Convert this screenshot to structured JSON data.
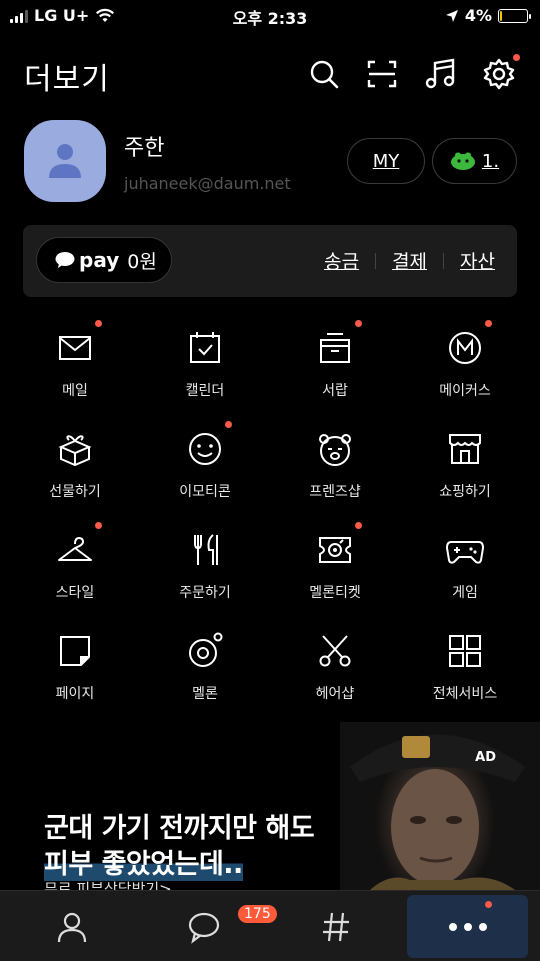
{
  "status": {
    "carrier": "LG U+",
    "time": "오후 2:33",
    "battery": "4%",
    "battery_level": 0.04
  },
  "header": {
    "title": "더보기",
    "icons": [
      "search-icon",
      "scan-icon",
      "music-icon",
      "settings-icon"
    ]
  },
  "profile": {
    "name": "주한",
    "email": "juhaneek@daum.net",
    "my_label": "MY",
    "emoticon_count": "1."
  },
  "pay": {
    "logo": "pay",
    "balance": "0원",
    "links": [
      "송금",
      "결제",
      "자산"
    ]
  },
  "grid": [
    {
      "label": "메일",
      "icon": "mail-icon",
      "dot": true
    },
    {
      "label": "캘린더",
      "icon": "calendar-icon",
      "dot": false
    },
    {
      "label": "서랍",
      "icon": "drawer-icon",
      "dot": true
    },
    {
      "label": "메이커스",
      "icon": "makers-icon",
      "dot": true
    },
    {
      "label": "선물하기",
      "icon": "gift-icon",
      "dot": false
    },
    {
      "label": "이모티콘",
      "icon": "emoticon-icon",
      "dot": true
    },
    {
      "label": "프렌즈샵",
      "icon": "friends-shop-icon",
      "dot": false
    },
    {
      "label": "쇼핑하기",
      "icon": "shopping-icon",
      "dot": false
    },
    {
      "label": "스타일",
      "icon": "hanger-icon",
      "dot": true
    },
    {
      "label": "주문하기",
      "icon": "fork-knife-icon",
      "dot": false
    },
    {
      "label": "멜론티켓",
      "icon": "ticket-icon",
      "dot": true
    },
    {
      "label": "게임",
      "icon": "gamepad-icon",
      "dot": false
    },
    {
      "label": "페이지",
      "icon": "page-icon",
      "dot": false
    },
    {
      "label": "멜론",
      "icon": "melon-icon",
      "dot": false
    },
    {
      "label": "헤어샵",
      "icon": "scissors-icon",
      "dot": false
    },
    {
      "label": "전체서비스",
      "icon": "grid-icon",
      "dot": false
    }
  ],
  "ad": {
    "tag": "AD",
    "line1": "군대 가기 전까지만 해도",
    "line2": "피부 좋았었는데..",
    "line3": "무료 피부상담받기>"
  },
  "tabs": {
    "chat_badge": "175",
    "items": [
      "person-icon",
      "chat-bubble-icon",
      "hash-icon",
      "more-dots-icon"
    ]
  },
  "colors": {
    "background": "#000000",
    "notification_dot": "#ff5a4a",
    "avatar": "#9aabdf",
    "active_tab": "#1d2f49",
    "badge": "#ff5a3a"
  }
}
